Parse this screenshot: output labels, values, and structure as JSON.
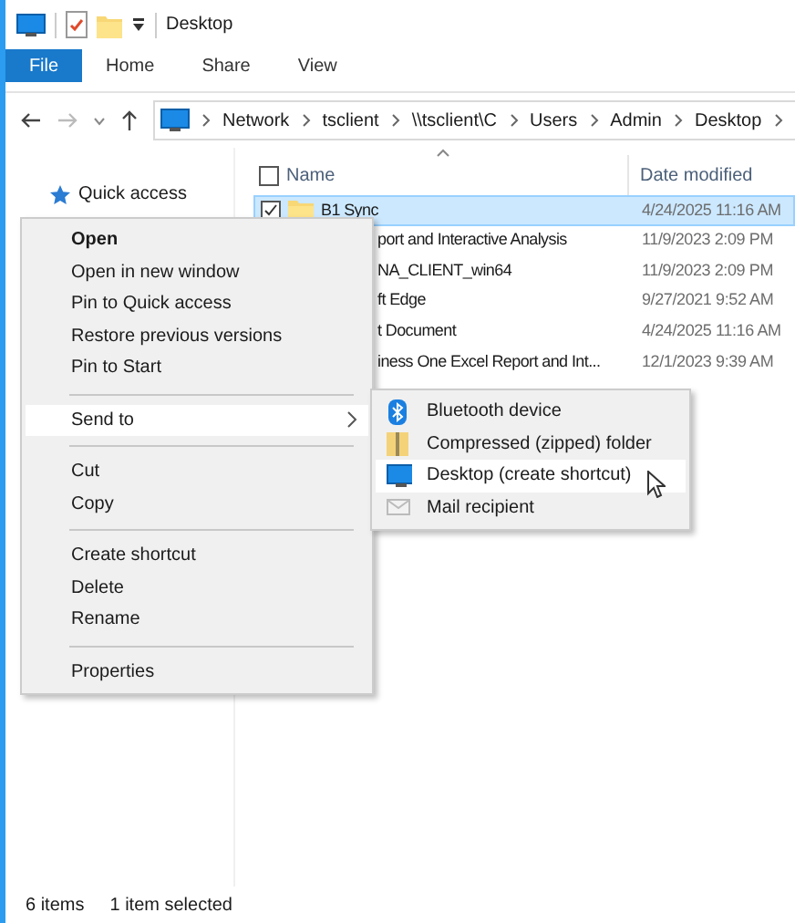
{
  "window": {
    "title": "Desktop"
  },
  "ribbon_tabs": [
    {
      "label": "File",
      "selected": true
    },
    {
      "label": "Home",
      "selected": false
    },
    {
      "label": "Share",
      "selected": false
    },
    {
      "label": "View",
      "selected": false
    }
  ],
  "address": {
    "segments": [
      "Network",
      "tsclient",
      "\\\\tsclient\\C",
      "Users",
      "Admin",
      "Desktop"
    ]
  },
  "nav_pane": {
    "items": [
      "Quick access"
    ]
  },
  "file_list": {
    "columns": [
      "Name",
      "Date modified"
    ],
    "all_checked": false,
    "rows": [
      {
        "name": "B1 Sync",
        "date": "4/24/2025 11:16 AM",
        "selected": true
      },
      {
        "name": "port and Interactive Analysis",
        "date": "11/9/2023 2:09 PM",
        "selected": false
      },
      {
        "name": "NA_CLIENT_win64",
        "date": "11/9/2023 2:09 PM",
        "selected": false
      },
      {
        "name": "ft Edge",
        "date": "9/27/2021 9:52 AM",
        "selected": false
      },
      {
        "name": "t Document",
        "date": "4/24/2025 11:16 AM",
        "selected": false
      },
      {
        "name": "iness One Excel Report and Int...",
        "date": "12/1/2023 9:39 AM",
        "selected": false
      }
    ]
  },
  "context_menu": {
    "items": [
      {
        "kind": "item",
        "label": "Open",
        "default": true,
        "selected": false
      },
      {
        "kind": "item",
        "label": "Open in new window",
        "default": false,
        "selected": false
      },
      {
        "kind": "item",
        "label": "Pin to Quick access",
        "default": false,
        "selected": false
      },
      {
        "kind": "item",
        "label": "Restore previous versions",
        "default": false,
        "selected": false
      },
      {
        "kind": "item",
        "label": "Pin to Start",
        "default": false,
        "selected": false
      },
      {
        "kind": "separator"
      },
      {
        "kind": "submenu",
        "label": "Send to",
        "default": false,
        "selected": true
      },
      {
        "kind": "separator"
      },
      {
        "kind": "item",
        "label": "Cut",
        "default": false,
        "selected": false
      },
      {
        "kind": "item",
        "label": "Copy",
        "default": false,
        "selected": false
      },
      {
        "kind": "separator"
      },
      {
        "kind": "item",
        "label": "Create shortcut",
        "default": false,
        "selected": false
      },
      {
        "kind": "item",
        "label": "Delete",
        "default": false,
        "selected": false
      },
      {
        "kind": "item",
        "label": "Rename",
        "default": false,
        "selected": false
      },
      {
        "kind": "separator"
      },
      {
        "kind": "item",
        "label": "Properties",
        "default": false,
        "selected": false
      }
    ]
  },
  "send_to_menu": {
    "items": [
      {
        "label": "Bluetooth device",
        "selected": false
      },
      {
        "label": "Compressed (zipped) folder",
        "selected": false
      },
      {
        "label": "Desktop (create shortcut)",
        "selected": true
      },
      {
        "label": "Mail recipient",
        "selected": false
      }
    ]
  },
  "status_bar": {
    "item_count": "6 items",
    "selection": "1 item selected"
  }
}
